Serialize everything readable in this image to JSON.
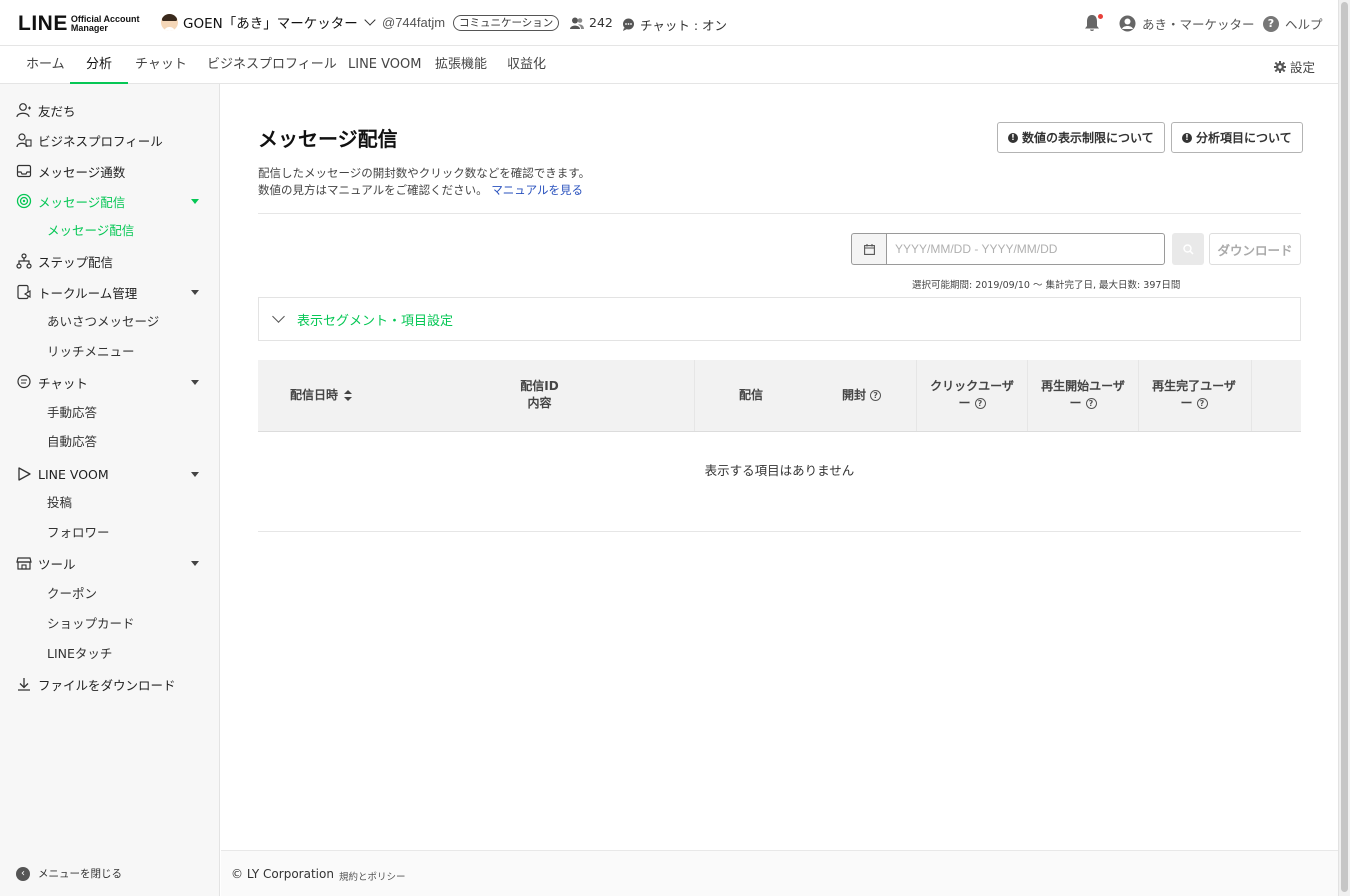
{
  "header": {
    "logo_main": "LINE",
    "logo_sub1": "Official Account",
    "logo_sub2": "Manager",
    "account_name": "GOEN「あき」マーケッター",
    "account_id": "@744fatjm",
    "plan_badge": "コミュニケーション",
    "friends_count": "242",
    "chat_status": "チャット : オン",
    "user_name": "あき・マーケッター",
    "help_label": "ヘルプ"
  },
  "nav": {
    "tabs": [
      {
        "label": "ホーム"
      },
      {
        "label": "分析"
      },
      {
        "label": "チャット"
      },
      {
        "label": "ビジネスプロフィール"
      },
      {
        "label": "LINE VOOM"
      },
      {
        "label": "拡張機能"
      },
      {
        "label": "収益化"
      }
    ],
    "settings_label": "設定"
  },
  "sidebar": {
    "items": [
      {
        "label": "友だち"
      },
      {
        "label": "ビジネスプロフィール"
      },
      {
        "label": "メッセージ通数"
      },
      {
        "label": "メッセージ配信"
      },
      {
        "label": "ステップ配信"
      },
      {
        "label": "トークルーム管理"
      },
      {
        "label": "チャット"
      },
      {
        "label": "LINE VOOM"
      },
      {
        "label": "ツール"
      },
      {
        "label": "ファイルをダウンロード"
      }
    ],
    "subs": [
      {
        "label": "メッセージ配信"
      },
      {
        "label": "あいさつメッセージ"
      },
      {
        "label": "リッチメニュー"
      },
      {
        "label": "手動応答"
      },
      {
        "label": "自動応答"
      },
      {
        "label": "投稿"
      },
      {
        "label": "フォロワー"
      },
      {
        "label": "クーポン"
      },
      {
        "label": "ショップカード"
      },
      {
        "label": "LINEタッチ"
      }
    ],
    "close_menu": "メニューを閉じる"
  },
  "main": {
    "title": "メッセージ配信",
    "btn_limit": "数値の表示制限について",
    "btn_items": "分析項目について",
    "desc_line1": "配信したメッセージの開封数やクリック数などを確認できます。",
    "desc_line2": "数値の見方はマニュアルをご確認ください。",
    "manual_link": "マニュアルを見る",
    "date_placeholder": "YYYY/MM/DD - YYYY/MM/DD",
    "download_label": "ダウンロード",
    "range_note": "選択可能期間: 2019/09/10 〜 集計完了日, 最大日数: 397日間",
    "segment_label": "表示セグメント・項目設定",
    "columns": {
      "date": "配信日時",
      "id_line1": "配信ID",
      "id_line2": "内容",
      "sent": "配信",
      "opened": "開封",
      "click_line1": "クリックユーザ",
      "click_line2": "ー",
      "play_start_line1": "再生開始ユーザ",
      "play_start_line2": "ー",
      "play_end_line1": "再生完了ユーザ",
      "play_end_line2": "ー"
    },
    "empty_text": "表示する項目はありません"
  },
  "footer": {
    "copyright": "© LY Corporation",
    "policy": "規約とポリシー"
  },
  "colors": {
    "accent": "#06c755",
    "link": "#2a52be"
  },
  "icons": [
    "user-icon",
    "id-card-icon",
    "inbox-icon",
    "broadcast-icon",
    "flow-icon",
    "tablet-icon",
    "chat-icon",
    "voom-icon",
    "shop-icon",
    "download-icon",
    "bell-icon",
    "help-icon",
    "gear-icon",
    "calendar-icon",
    "search-icon",
    "info-icon",
    "sort-icon",
    "question-icon"
  ]
}
